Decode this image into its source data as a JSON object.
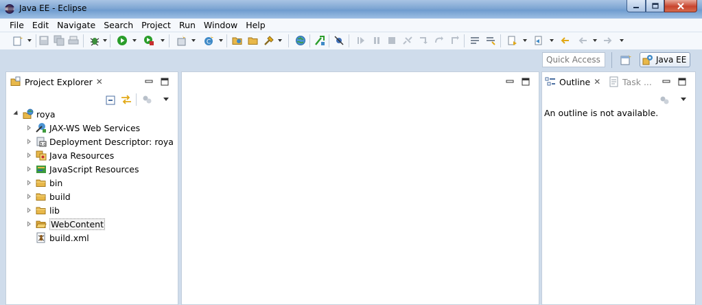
{
  "window": {
    "title": "Java EE - Eclipse"
  },
  "menu": [
    "File",
    "Edit",
    "Navigate",
    "Search",
    "Project",
    "Run",
    "Window",
    "Help"
  ],
  "quick_access": {
    "placeholder": "Quick Access"
  },
  "perspective": {
    "active_label": "Java EE"
  },
  "project_explorer": {
    "tab_label": "Project Explorer",
    "project": "roya",
    "items": [
      {
        "label": "JAX-WS Web Services",
        "icon": "web-services-icon"
      },
      {
        "label": "Deployment Descriptor: roya",
        "icon": "deployment-descriptor-icon"
      },
      {
        "label": "Java Resources",
        "icon": "java-resources-icon"
      },
      {
        "label": "JavaScript Resources",
        "icon": "javascript-resources-icon"
      },
      {
        "label": "bin",
        "icon": "folder-icon"
      },
      {
        "label": "build",
        "icon": "folder-icon"
      },
      {
        "label": "lib",
        "icon": "folder-icon"
      },
      {
        "label": "WebContent",
        "icon": "folder-open-icon"
      },
      {
        "label": "build.xml",
        "icon": "ant-file-icon"
      }
    ]
  },
  "outline": {
    "tab_label": "Outline",
    "inactive_tab_label": "Task ...",
    "message": "An outline is not available."
  },
  "colors": {
    "title_bar": "#7fa6d3",
    "workspace_bg": "#cfdceb",
    "toolbar_bg": "#f5f8fc",
    "panel_border": "#c2cedc",
    "run_green": "#2a9d2a",
    "folder_yellow": "#e8b84a"
  }
}
